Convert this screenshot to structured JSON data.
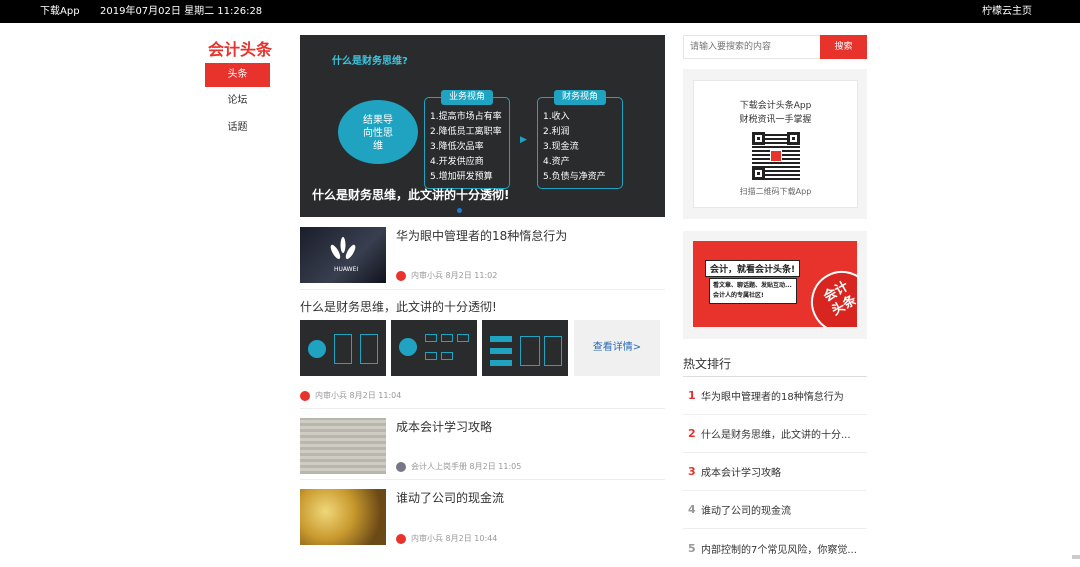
{
  "topbar": {
    "download": "下载App",
    "datetime": "2019年07月02日 星期二 11:26:28",
    "home": "柠檬云主页"
  },
  "logo": "会计头条",
  "nav": [
    "头条",
    "论坛",
    "话题"
  ],
  "banner": {
    "question": "什么是财务思维?",
    "circle": [
      "结果导",
      "向性思",
      "维"
    ],
    "box1": {
      "header": "业务视角",
      "items": [
        "1.提高市场占有率",
        "2.降低员工离职率",
        "3.降低次品率",
        "4.开发供应商",
        "5.增加研发预算"
      ]
    },
    "arrow": "▶",
    "box2": {
      "header": "财务视角",
      "items": [
        "1.收入",
        "2.利润",
        "3.现金流",
        "4.资产",
        "5.负债与净资产"
      ]
    },
    "caption": "什么是财务思维，此文讲的十分透彻!"
  },
  "articles": [
    {
      "title": "华为眼中管理者的18种惰怠行为",
      "author": "内审小兵",
      "date": "8月2日 11:02",
      "thumb_text": "HUAWEI"
    },
    {
      "title": "什么是财务思维，此文讲的十分透彻!",
      "author": "内审小兵",
      "date": "8月2日 11:04",
      "more": "查看详情>"
    },
    {
      "title": "成本会计学习攻略",
      "author": "会计人上岗手册",
      "date": "8月2日 11:05"
    },
    {
      "title": "谁动了公司的现金流",
      "author": "内审小兵",
      "date": "8月2日 10:44"
    }
  ],
  "search": {
    "placeholder": "请输入要搜索的内容",
    "button": "搜索"
  },
  "app_card": {
    "line1": "下载会计头条App",
    "line2": "财税资讯一手掌握",
    "line3": "扫描二维码下载App"
  },
  "ad": {
    "line1": "会计，就看会计头条!",
    "line2a": "看文章、聊话题、发贴互动...",
    "line2b": "会计人的专属社区!",
    "seal1": "会计",
    "seal2": "头条"
  },
  "hot": {
    "heading": "热文排行",
    "items": [
      {
        "rank": "1",
        "title": "华为眼中管理者的18种惰怠行为"
      },
      {
        "rank": "2",
        "title": "什么是财务思维，此文讲的十分..."
      },
      {
        "rank": "3",
        "title": "成本会计学习攻略"
      },
      {
        "rank": "4",
        "title": "谁动了公司的现金流"
      },
      {
        "rank": "5",
        "title": "内部控制的7个常见风险，你察觉..."
      }
    ]
  },
  "colors": {
    "accent": "#e8322c",
    "teal": "#1fa3c0"
  }
}
